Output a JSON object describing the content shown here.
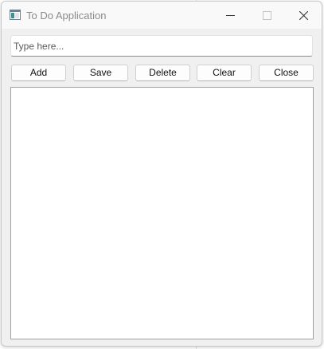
{
  "window": {
    "title": "To Do Application"
  },
  "input": {
    "value": "",
    "placeholder": "Type here..."
  },
  "buttons": {
    "add": "Add",
    "save": "Save",
    "delete": "Delete",
    "clear": "Clear",
    "close": "Close"
  },
  "list": {
    "items": []
  },
  "icons": {
    "app": "app-window-icon",
    "minimize": "minimize-icon",
    "maximize": "maximize-icon",
    "close": "close-icon"
  },
  "colors": {
    "window_bg": "#f0f0f0",
    "titlebar_bg": "#f9f9f9",
    "title_text": "#8a8a8a",
    "list_border": "#a0a0a0"
  }
}
